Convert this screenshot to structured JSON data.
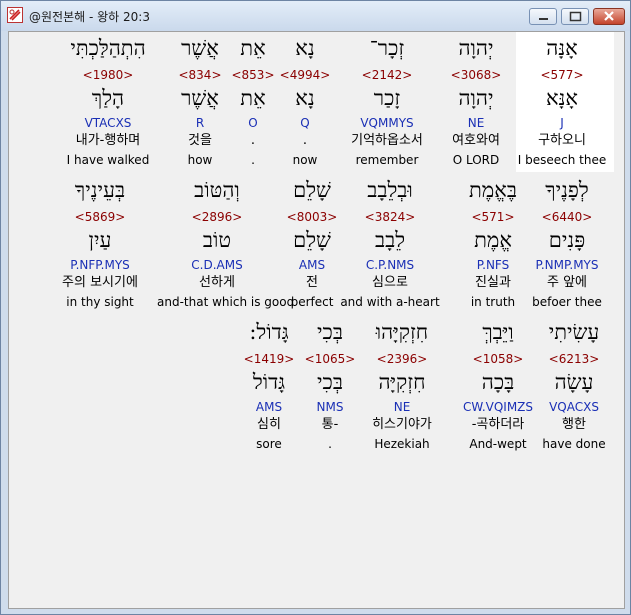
{
  "window": {
    "title": "@원전본해 - 왕하 20:3"
  },
  "rows": [
    {
      "words": [
        {
          "heb": "אָנָּה",
          "strong": "<577>",
          "lemma": "אָנָּא",
          "morph": "J",
          "kor": "구하오니",
          "eng": "I beseech thee",
          "highlighted": true
        },
        {
          "heb": "יְהוָה",
          "strong": "<3068>",
          "lemma": "יְהוָה",
          "morph": "NE",
          "kor": "여호와여",
          "eng": "O LORD"
        },
        {
          "heb": "זְכָר־",
          "strong": "<2142>",
          "lemma": "זָכַר",
          "morph": "VQMMYS",
          "kor": "기억하옵소서",
          "eng": "remember"
        },
        {
          "heb": "נָא",
          "strong": "<4994>",
          "lemma": "נָא",
          "morph": "Q",
          "kor": ".",
          "eng": "now"
        },
        {
          "heb": "אֵת",
          "strong": "<853>",
          "lemma": "אֵת",
          "morph": "O",
          "kor": ".",
          "eng": "."
        },
        {
          "heb": "אֲשֶׁר",
          "strong": "<834>",
          "lemma": "אֲשֶׁר",
          "morph": "R",
          "kor": "것을",
          "eng": "how"
        },
        {
          "heb": "הִתְהַלַּכְתִּי",
          "strong": "<1980>",
          "lemma": "הָלַךְ",
          "morph": "VTACXS",
          "kor": "내가-행하며",
          "eng": "I have walked"
        }
      ]
    },
    {
      "words": [
        {
          "heb": "לְפָנֶיךָ",
          "strong": "<6440>",
          "lemma": "פָּנִים",
          "morph": "P.NMP.MYS",
          "kor": "주 앞에",
          "eng": "befoer thee"
        },
        {
          "heb": "בֶּאֱמֶת",
          "strong": "<571>",
          "lemma": "אֱמֶת",
          "morph": "P.NFS",
          "kor": "진실과",
          "eng": "in truth"
        },
        {
          "heb": "וּבְלֵבָב",
          "strong": "<3824>",
          "lemma": "לֵבָב",
          "morph": "C.P.NMS",
          "kor": "심으로",
          "eng": "and with a-heart"
        },
        {
          "heb": "שָׁלֵם",
          "strong": "<8003>",
          "lemma": "שָׁלֵם",
          "morph": "AMS",
          "kor": "전",
          "eng": "perfect"
        },
        {
          "heb": "וְהַטּוֹב",
          "strong": "<2896>",
          "lemma": "טוֹב",
          "morph": "C.D.AMS",
          "kor": "선하게",
          "eng": "and-that which is good"
        },
        {
          "heb": "בְּעֵינֶיךָ",
          "strong": "<5869>",
          "lemma": "עַיִן",
          "morph": "P.NFP.MYS",
          "kor": "주의 보시기에",
          "eng": "in thy sight"
        }
      ]
    },
    {
      "words": [
        {
          "heb": "עָשִׂיתִי",
          "strong": "<6213>",
          "lemma": "עָשָׂה",
          "morph": "VQACXS",
          "kor": "행한",
          "eng": "have done"
        },
        {
          "heb": "וַיֵּבְךְּ",
          "strong": "<1058>",
          "lemma": "בָּכָה",
          "morph": "CW.VQIMZS",
          "kor": "-곡하더라",
          "eng": "And-wept"
        },
        {
          "heb": "חִזְקִיָּהוּ",
          "strong": "<2396>",
          "lemma": "חִזְקִיָּה",
          "morph": "NE",
          "kor": "히스기야가",
          "eng": "Hezekiah"
        },
        {
          "heb": "בְּכִי",
          "strong": "<1065>",
          "lemma": "בְּכִי",
          "morph": "NMS",
          "kor": "통-",
          "eng": "."
        },
        {
          "heb": ":גָּדוֹל",
          "strong": "<1419>",
          "lemma": "גָּדוֹל",
          "morph": "AMS",
          "kor": "심히",
          "eng": "sore"
        }
      ]
    }
  ]
}
